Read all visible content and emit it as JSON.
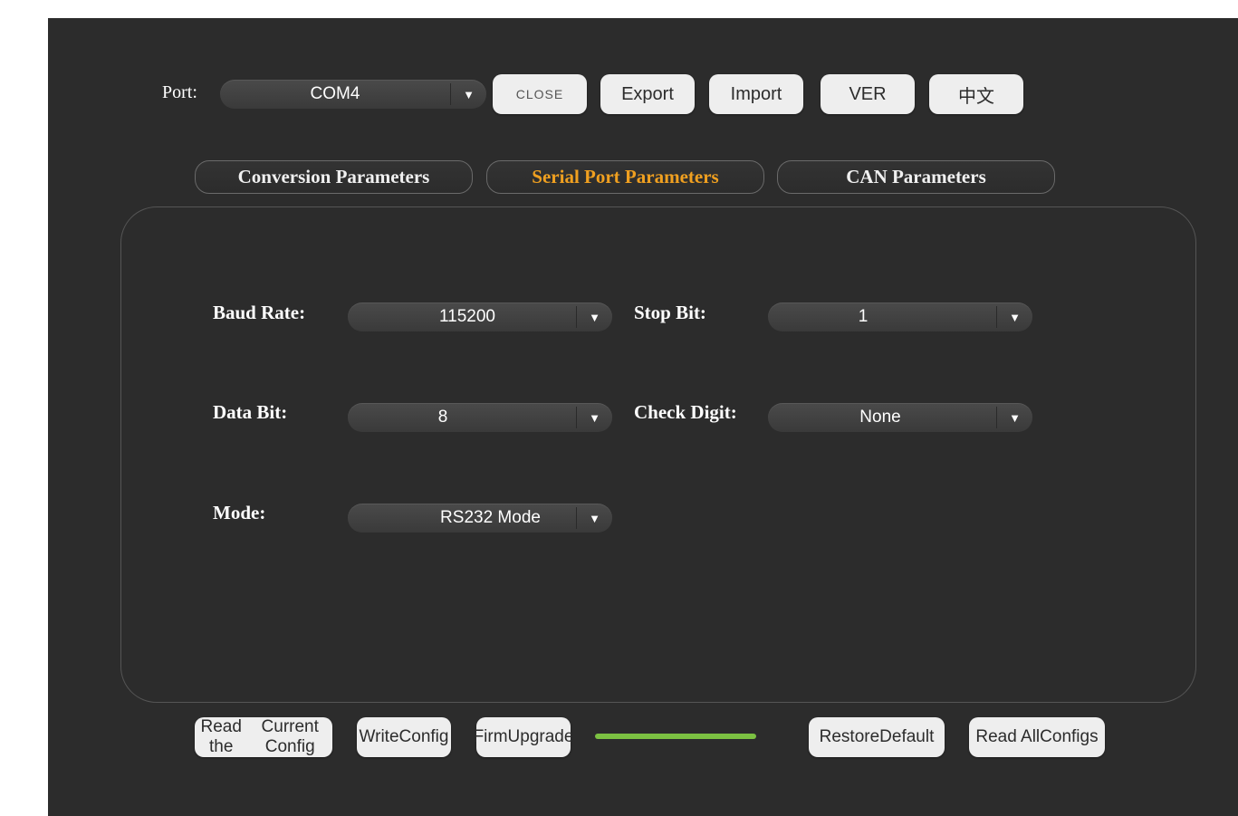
{
  "toolbar": {
    "port_label": "Port:",
    "port_value": "COM4",
    "close_label": "CLOSE",
    "export_label": "Export",
    "import_label": "Import",
    "ver_label": "VER",
    "lang_label": "中文"
  },
  "tabs": [
    {
      "label": "Conversion Parameters",
      "active": false
    },
    {
      "label": "Serial Port Parameters",
      "active": true
    },
    {
      "label": "CAN Parameters",
      "active": false
    }
  ],
  "form": {
    "baud_rate": {
      "label": "Baud Rate:",
      "value": "115200"
    },
    "stop_bit": {
      "label": "Stop Bit:",
      "value": "1"
    },
    "data_bit": {
      "label": "Data Bit:",
      "value": "8"
    },
    "check_digit": {
      "label": "Check Digit:",
      "value": "None"
    },
    "mode": {
      "label": "Mode:",
      "value": "RS232 Mode"
    }
  },
  "bottom": {
    "read_current": [
      "Read the",
      "Current Config"
    ],
    "write_config": [
      "Write",
      "Config"
    ],
    "firm_upgrade": [
      "Firm",
      "Upgrade"
    ],
    "restore_default": [
      "Restore",
      "Default"
    ],
    "read_all": [
      "Read All",
      "Configs"
    ],
    "progress": 1.0
  },
  "colors": {
    "background": "#2c2c2c",
    "active_tab": "#f0a020",
    "progress": "#7cc142"
  },
  "icons": {
    "dropdown": "caret-down-icon"
  }
}
